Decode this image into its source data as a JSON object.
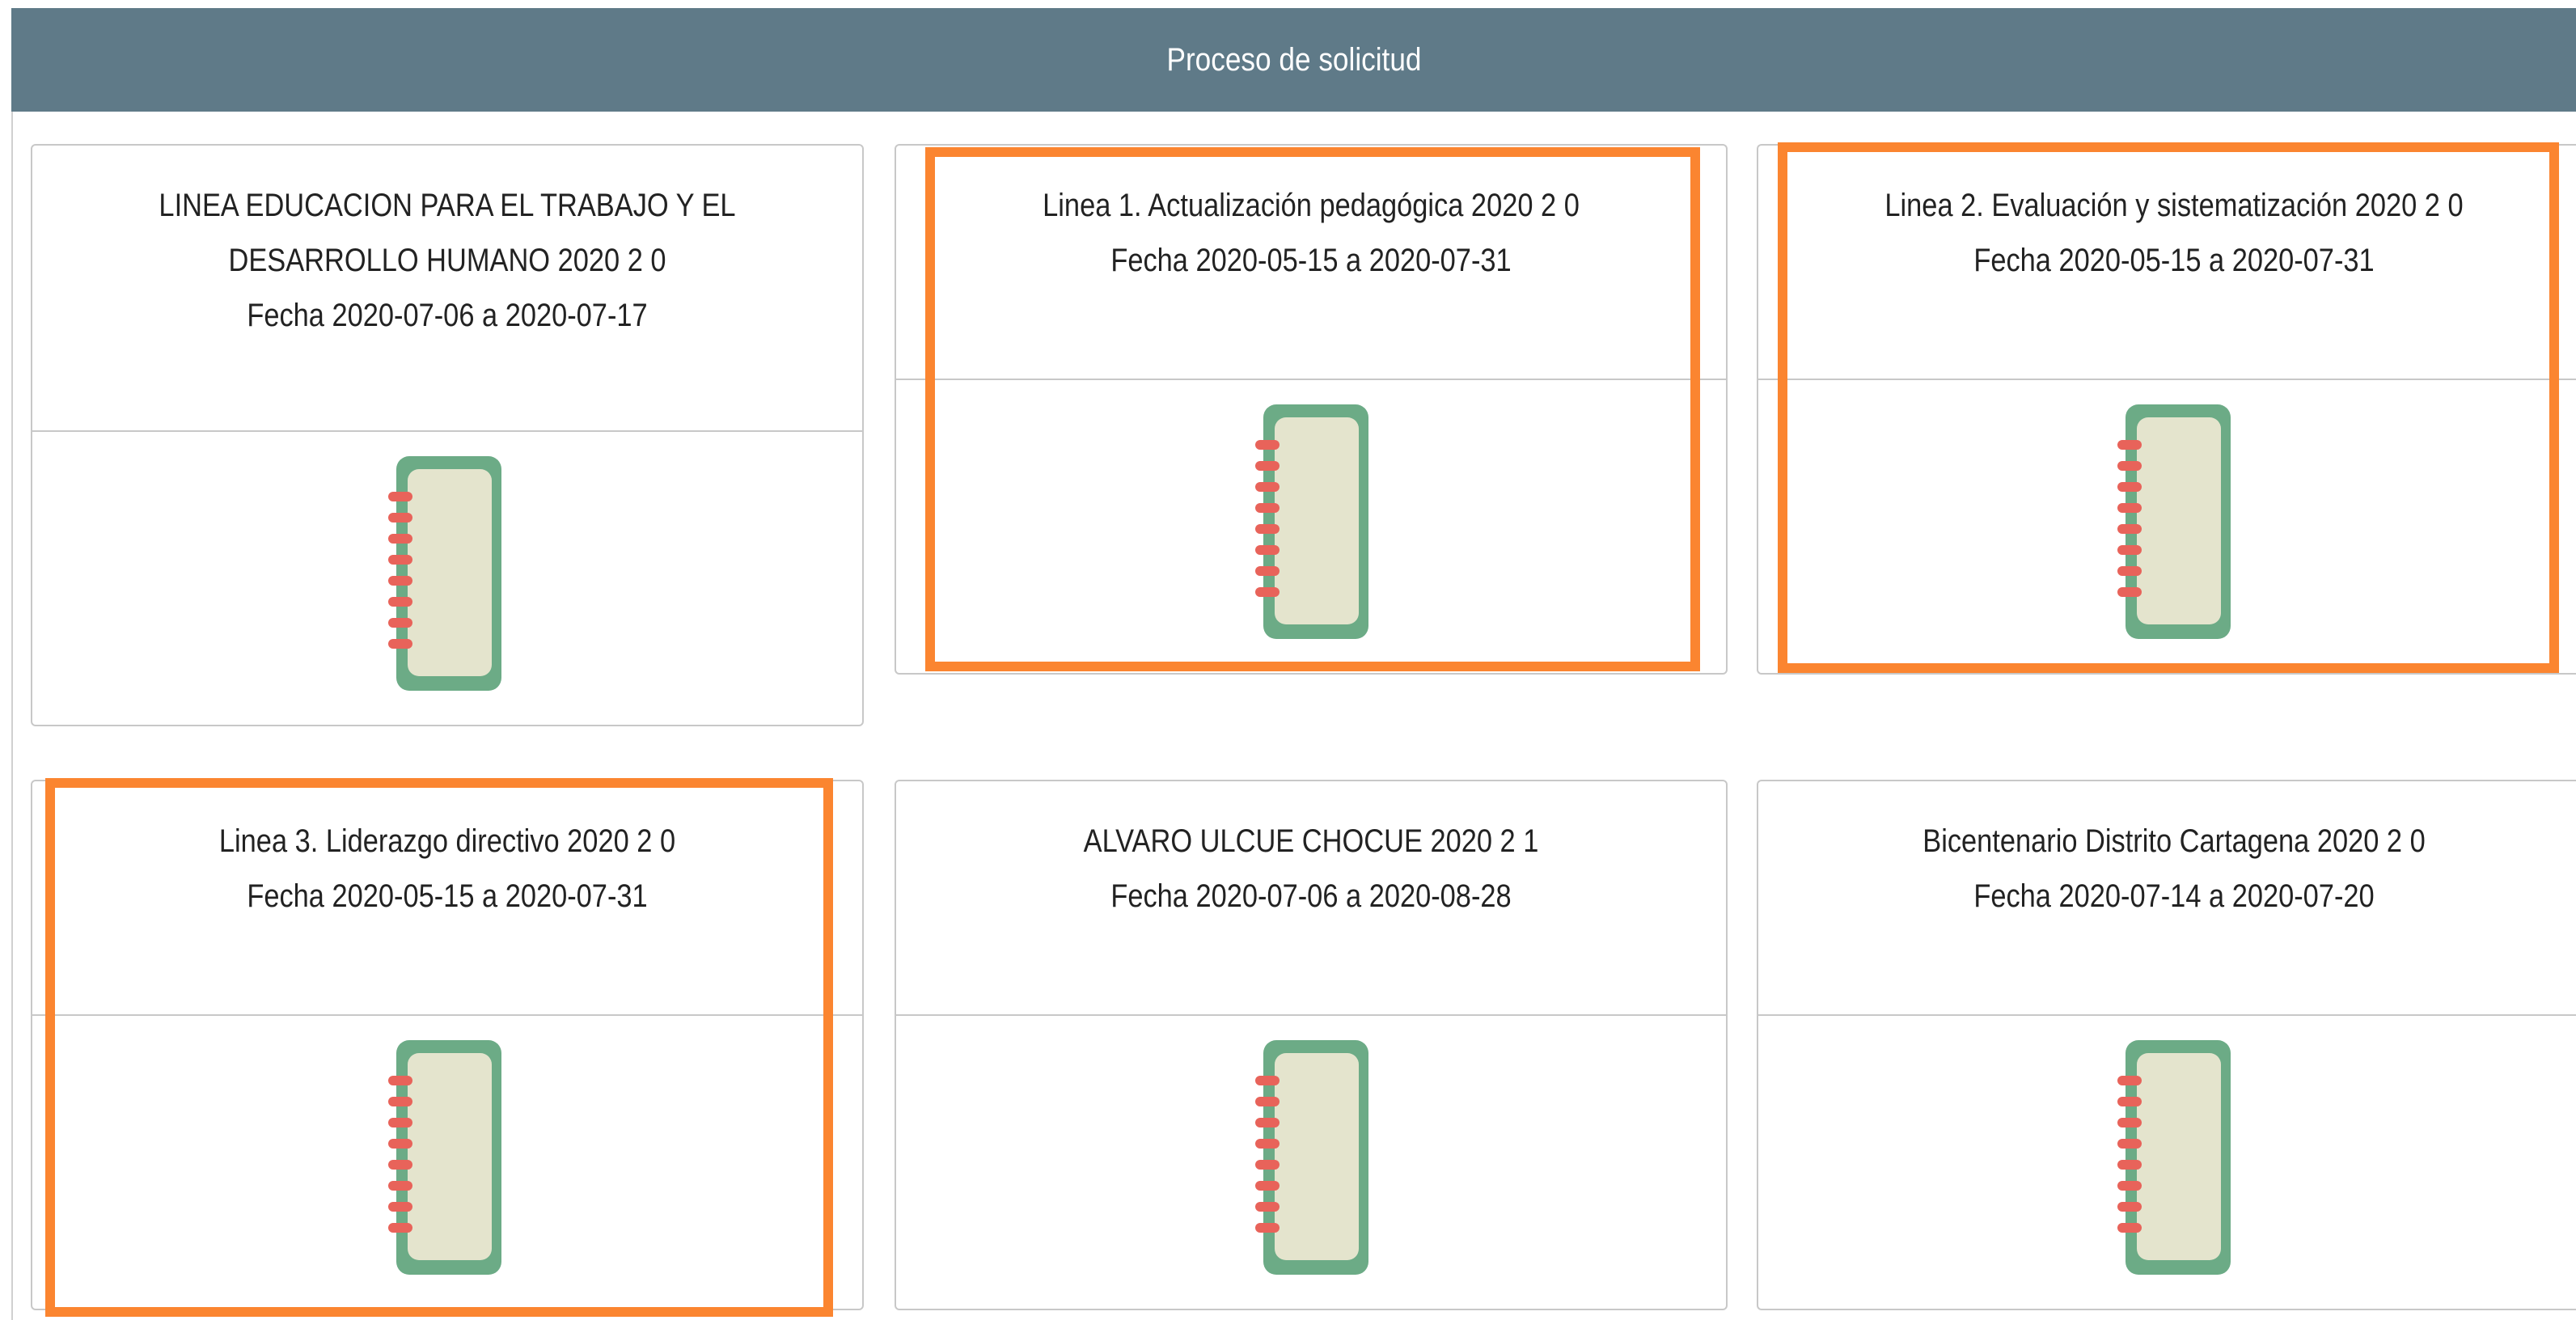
{
  "header": {
    "title": "Proceso de solicitud"
  },
  "colors": {
    "header_bg": "#5f7a88",
    "highlight": "#fb8530",
    "notebook_cover": "#6cab86",
    "notebook_page": "#e4e4cd",
    "notebook_rings": "#e8635a"
  },
  "cards": [
    {
      "title_line_1": "LINEA EDUCACION PARA EL TRABAJO Y EL",
      "title_line_2": "DESARROLLO HUMANO 2020 2 0",
      "date": "Fecha 2020-07-06 a 2020-07-17",
      "icon": "notebook-icon",
      "highlighted": false
    },
    {
      "title_line_1": "Linea 1. Actualización pedagógica 2020 2 0",
      "date": "Fecha 2020-05-15 a 2020-07-31",
      "icon": "notebook-icon",
      "highlighted": true
    },
    {
      "title_line_1": "Linea 2. Evaluación y sistematización 2020 2 0",
      "date": "Fecha 2020-05-15 a 2020-07-31",
      "icon": "notebook-icon",
      "highlighted": true
    },
    {
      "title_line_1": "Linea 3. Liderazgo directivo 2020 2 0",
      "date": "Fecha 2020-05-15 a 2020-07-31",
      "icon": "notebook-icon",
      "highlighted": true
    },
    {
      "title_line_1": "ALVARO ULCUE CHOCUE 2020 2 1",
      "date": "Fecha 2020-07-06 a 2020-08-28",
      "icon": "notebook-icon",
      "highlighted": false
    },
    {
      "title_line_1": "Bicentenario Distrito Cartagena 2020 2 0",
      "date": "Fecha 2020-07-14 a 2020-07-20",
      "icon": "notebook-icon",
      "highlighted": false
    }
  ]
}
